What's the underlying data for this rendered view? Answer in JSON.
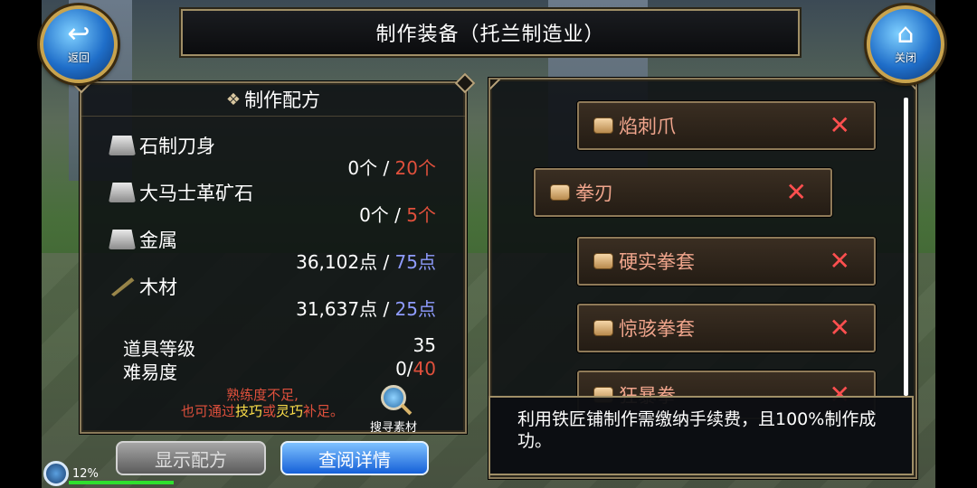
{
  "header": {
    "title": "制作装备（托兰制造业）",
    "back_label": "返回",
    "close_label": "关闭"
  },
  "recipe_panel": {
    "title": "制作配方",
    "materials": [
      {
        "name": "石制刀身",
        "icon": "ingot-icon",
        "have": "0个",
        "sep": " / ",
        "need": "20个",
        "need_color": "#e0503c"
      },
      {
        "name": "大马士革矿石",
        "icon": "ingot-icon",
        "have": "0个",
        "sep": " / ",
        "need": "5个",
        "need_color": "#e0503c"
      },
      {
        "name": "金属",
        "icon": "ingot-icon",
        "have": "36,102点",
        "sep": " / ",
        "need": "75点",
        "need_color": "#8f9cff"
      },
      {
        "name": "木材",
        "icon": "wood-icon",
        "have": "31,637点",
        "sep": " / ",
        "need": "25点",
        "need_color": "#8f9cff"
      }
    ],
    "item_level_label": "道具等级",
    "item_level_value": "35",
    "difficulty_label": "难易度",
    "difficulty_have": "0/",
    "difficulty_need": "40",
    "warning_line1": "熟练度不足,",
    "warning_pre": "也可通过",
    "warning_skill": "技巧",
    "warning_or": "或",
    "warning_agility": "灵巧",
    "warning_post": "补足。",
    "search_label": "搜寻素材"
  },
  "buttons": {
    "show_recipe": "显示配方",
    "view_details": "查阅详情"
  },
  "recipe_list": [
    {
      "name": "焰刺爪",
      "icon": "scroll-icon"
    },
    {
      "name": "拳刃",
      "icon": "scroll-icon"
    },
    {
      "name": "硬实拳套",
      "icon": "scroll-icon"
    },
    {
      "name": "惊骇拳套",
      "icon": "scroll-icon"
    },
    {
      "name": "狂暴拳",
      "icon": "scroll-icon"
    }
  ],
  "message": "利用铁匠铺制作需缴纳手续费，且100%制作成功。",
  "hud": {
    "percent": "12%"
  },
  "colors": {
    "accent_blue": "#1560d8",
    "warning_red": "#e0503c",
    "enough_blue": "#8f9cff",
    "frame_gold": "#a08f67"
  }
}
